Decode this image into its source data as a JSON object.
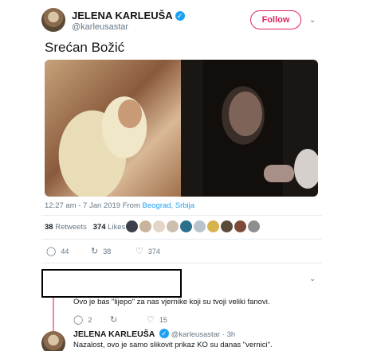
{
  "tweet": {
    "author_name": "JELENA KARLEUŠA",
    "verified_mark": "✓",
    "author_handle": "@karleusastar",
    "follow_label": "Follow",
    "text": "Srećan Božić",
    "time": "12:27 am - 7 Jan 2019",
    "from_label": "From",
    "location": "Beograd, Srbija",
    "retweets_count": "38",
    "retweets_label": "Retweets",
    "likes_count": "374",
    "likes_label": "Likes",
    "liker_colors": [
      "#3b3f4a",
      "#c8b49a",
      "#e3d6c8",
      "#cdbfb0",
      "#2b6f8a",
      "#b7c2cc",
      "#d8b24a",
      "#5a4a3a",
      "#7d4a3a",
      "#8e8e8e"
    ],
    "actions": {
      "replies": "44",
      "retweets": "38",
      "likes": "374"
    },
    "icons": {
      "reply": "reply-icon",
      "retweet": "retweet-icon",
      "like": "heart-icon",
      "more": "chevron-down-icon"
    }
  },
  "reply1": {
    "text": "Ovo je bas \"lijepo\" za nas vjernike koji su tvoji veliki fanovi.",
    "replies": "2",
    "retweets": "",
    "likes": "15"
  },
  "reply2": {
    "author_name": "JELENA KARLEUŠA",
    "meta": "@karleusastar · 3h",
    "text": "Nazalost, ovo je samo slikovit prikaz KO su danas \"vernici\"."
  },
  "colors": {
    "accent": "#1da1f2",
    "follow": "#e0245e",
    "muted": "#657786"
  }
}
